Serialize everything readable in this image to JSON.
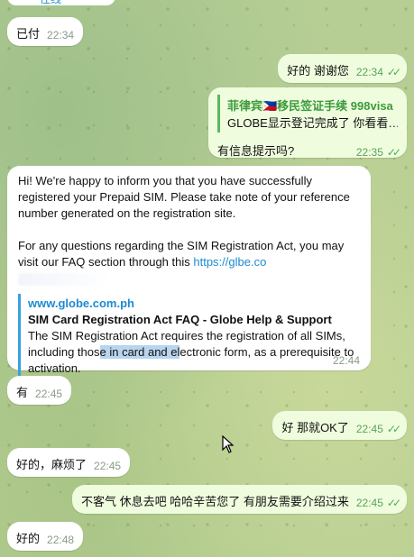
{
  "top_link": "往线",
  "messages": [
    {
      "text": "已付",
      "time": "22:34"
    },
    {
      "text": "好的 谢谢您",
      "time": "22:34"
    },
    {
      "reply_name": "菲律宾🇵🇭移民签证手续 998visa",
      "reply_text": "GLOBE显示登记完成了 你看看…",
      "text": "有信息提示吗?",
      "time": "22:35"
    },
    {
      "para1": "Hi! We're happy to inform you that you have successfully registered your Prepaid SIM. Please take note of your reference number generated on the registration site.",
      "para2_prefix": "For any questions regarding the SIM Registration Act, you may visit our FAQ section through this ",
      "para2_link": "https://glbe.co",
      "preview_site": "www.globe.com.ph",
      "preview_title": "SIM Card Registration Act FAQ - Globe Help & Support",
      "preview_text_1": "The SIM Registration Act requires the registration of all SIMs, including thos",
      "preview_text_hl": "e in card and el",
      "preview_text_2": "ectronic form, as a prerequisite to activation.",
      "time": "22:44"
    },
    {
      "text": "有",
      "time": "22:45"
    },
    {
      "text": "好 那就OK了",
      "time": "22:45"
    },
    {
      "text": "好的，麻烦了",
      "time": "22:45"
    },
    {
      "text": "不客气 休息去吧 哈哈辛苦您了 有朋友需要介绍过来",
      "time": "22:45"
    },
    {
      "text": "好的",
      "time": "22:48"
    }
  ],
  "colors": {
    "incoming": "#ffffff",
    "outgoing": "#effdde",
    "link": "#1d8bd1",
    "check": "#4fae4e"
  }
}
